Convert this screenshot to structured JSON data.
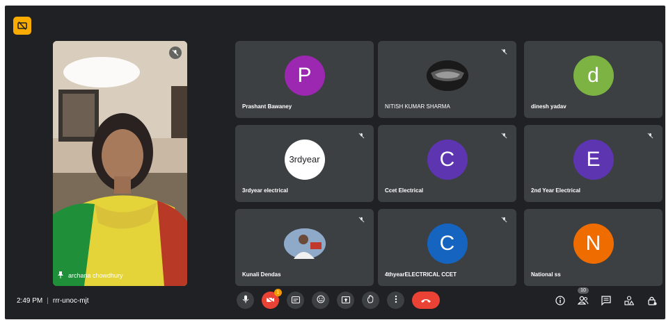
{
  "meeting": {
    "time": "2:49 PM",
    "separator": "|",
    "code": "rrr-unoc-mjt"
  },
  "presenter": {
    "name": "archana chowdhury"
  },
  "participants": [
    {
      "name": "Prashant Bawaney",
      "avatar_letter": "P",
      "avatar_color": "#9c27b0",
      "muted": false,
      "type": "letter"
    },
    {
      "name": "NITISH KUMAR SHARMA",
      "avatar_letter": "",
      "avatar_color": "",
      "muted": true,
      "type": "photo-mask"
    },
    {
      "name": "dinesh yadav",
      "avatar_letter": "d",
      "avatar_color": "#7cb342",
      "muted": false,
      "type": "letter"
    },
    {
      "name": "3rdyear electrical",
      "avatar_letter": "3rdyear",
      "avatar_color": "#ffffff",
      "muted": true,
      "type": "text-white"
    },
    {
      "name": "Ccet Electrical",
      "avatar_letter": "C",
      "avatar_color": "#5e35b1",
      "muted": true,
      "type": "letter"
    },
    {
      "name": "2nd Year Electrical",
      "avatar_letter": "E",
      "avatar_color": "#5e35b1",
      "muted": true,
      "type": "letter"
    },
    {
      "name": "Kunali Dendas",
      "avatar_letter": "",
      "avatar_color": "",
      "muted": true,
      "type": "photo-person"
    },
    {
      "name": "4thyearELECTRICAL CCET",
      "avatar_letter": "C",
      "avatar_color": "#1565c0",
      "muted": true,
      "type": "letter"
    },
    {
      "name": "National ss",
      "avatar_letter": "N",
      "avatar_color": "#ef6c00",
      "muted": false,
      "type": "letter"
    }
  ],
  "controls": {
    "video_badge": "1",
    "people_count": "10"
  },
  "icons": {
    "logo": "present-off-icon",
    "mic": "mic-icon",
    "video": "video-off-icon",
    "captions": "captions-icon",
    "emoji": "emoji-icon",
    "present": "present-icon",
    "hand": "raise-hand-icon",
    "more": "more-vert-icon",
    "end": "end-call-icon",
    "info": "info-icon",
    "people": "people-icon",
    "chat": "chat-icon",
    "activities": "activities-icon",
    "host": "host-controls-icon"
  },
  "colors": {
    "background": "#202124",
    "tile": "#3c4043",
    "end_call": "#ea4335",
    "logo": "#f9ab00"
  }
}
